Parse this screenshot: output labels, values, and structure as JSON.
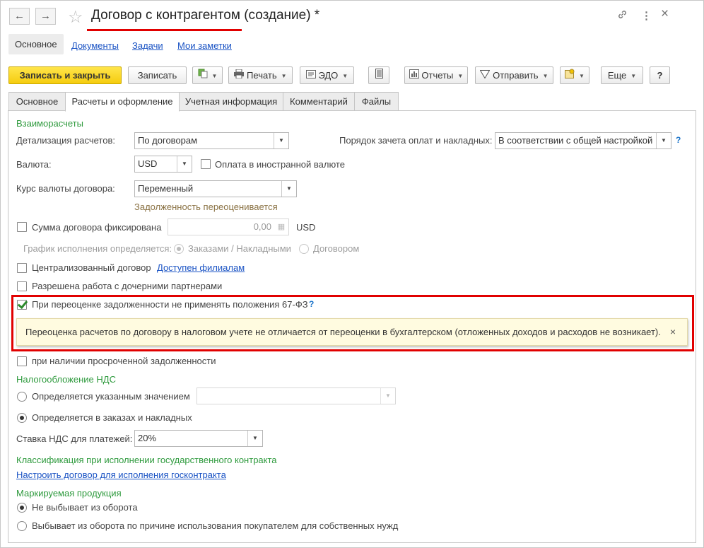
{
  "window": {
    "title": "Договор с контрагентом (создание) *",
    "back_icon": "←",
    "forward_icon": "→",
    "star_icon": "☆",
    "link_icon": "🔗",
    "menu_icon": "⋮",
    "close_icon": "×"
  },
  "top_links": [
    {
      "label": "Основное"
    },
    {
      "label": "Документы"
    },
    {
      "label": "Задачи"
    },
    {
      "label": "Мои заметки"
    }
  ],
  "toolbar": {
    "save_close": "Записать и закрыть",
    "save": "Записать",
    "print": "Печать",
    "edo": "ЭДО",
    "reports": "Отчеты",
    "send": "Отправить",
    "more": "Еще",
    "help": "?"
  },
  "tabs": [
    {
      "label": "Основное"
    },
    {
      "label": "Расчеты и оформление"
    },
    {
      "label": "Учетная информация"
    },
    {
      "label": "Комментарий"
    },
    {
      "label": "Файлы"
    }
  ],
  "mutual": {
    "section": "Взаиморасчеты",
    "detail_label": "Детализация расчетов:",
    "detail_value": "По договорам",
    "offset_label": "Порядок зачета оплат и накладных:",
    "offset_value": "В соответствии с общей настройкой",
    "currency_label": "Валюта:",
    "currency_value": "USD",
    "foreign_pay_label": "Оплата в иностранной валюте",
    "rate_label": "Курс валюты договора:",
    "rate_value": "Переменный",
    "revalue_hint": "Задолженность переоценивается",
    "fixed_sum_label": "Сумма договора фиксирована",
    "fixed_sum_value": "0,00",
    "fixed_sum_currency": "USD",
    "schedule_label": "График исполнения определяется:",
    "schedule_opt1": "Заказами / Накладными",
    "schedule_opt2": "Договором",
    "centralized_label": "Централизованный договор",
    "branches_link": "Доступен филиалам",
    "subsidiary_label": "Разрешена работа с дочерними партнерами",
    "law67_label": "При переоценке задолженности не применять положения 67-ФЗ",
    "law67_help": "?",
    "tooltip_text": "Переоценка расчетов по договору в налоговом учете не отличается от переоценки в бухгалтерском (отложенных доходов и расходов не возникает).",
    "tooltip_close": "×",
    "overdue_label": "при наличии просроченной задолженности"
  },
  "vat": {
    "section": "Налогообложение НДС",
    "opt_specified": "Определяется указанным значением",
    "opt_orders": "Определяется в заказах и накладных",
    "rate_label": "Ставка НДС для платежей:",
    "rate_value": "20%"
  },
  "gov": {
    "section": "Классификация при исполнении государственного контракта",
    "link": "Настроить договор для исполнения госконтракта"
  },
  "marking": {
    "section": "Маркируемая продукция",
    "opt1": "Не выбывает из оборота",
    "opt2": "Выбывает из оборота по причине использования покупателем для собственных нужд"
  },
  "colors": {
    "accent_yellow": "#f5cc0f",
    "section_green": "#2e9a3d",
    "link_blue": "#1a53c4",
    "highlight_red": "#e10000"
  }
}
